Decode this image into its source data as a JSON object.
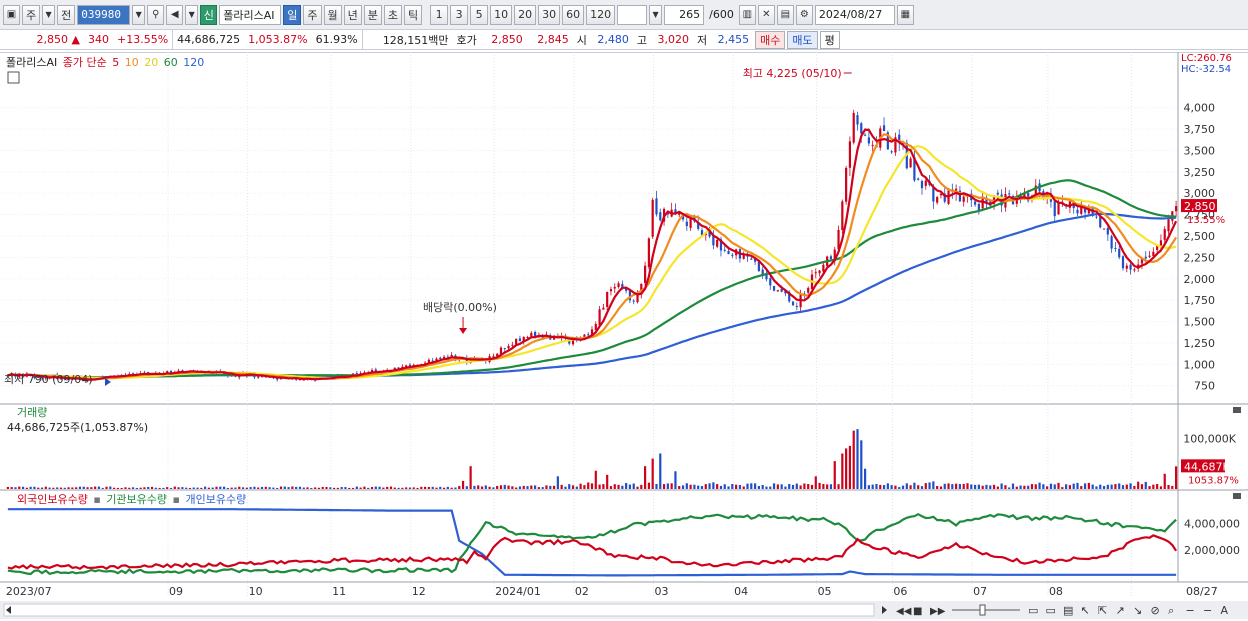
{
  "toolbar": {
    "market": "주",
    "price_type": "전",
    "code": "039980",
    "flag": "신",
    "name": "폴라리스AI",
    "periods": [
      "일",
      "주",
      "월",
      "년",
      "분",
      "초",
      "틱"
    ],
    "active_period": "일",
    "intervals": [
      "1",
      "3",
      "5",
      "10",
      "20",
      "30",
      "60",
      "120"
    ],
    "count": "265",
    "count_total": "/600",
    "date": "2024/08/27"
  },
  "quote": {
    "price": "2,850",
    "change_arrow": "▲",
    "change": "340",
    "change_pct": "+13.55%",
    "volume": "44,686,725",
    "volume_pct": "1,053.87%",
    "turnover": "61.93%",
    "trade_value": "128,151백만",
    "bid_label": "호가",
    "bid": "2,850",
    "ask": "2,845",
    "open_label": "시",
    "open": "2,480",
    "high_label": "고",
    "high": "3,020",
    "low_label": "저",
    "low": "2,455",
    "buy_button": "매수",
    "sell_button": "매도",
    "eval_button": "평"
  },
  "colors": {
    "up": "#d0021b",
    "down": "#1f4fc8",
    "ma5": "#d0021b",
    "ma10": "#f08c1e",
    "ma20": "#f5e62b",
    "ma60": "#1e8a3c",
    "ma120": "#2e5fd4",
    "foreign": "#d0021b",
    "institution": "#1e8a3c",
    "individual": "#2e5fd4"
  },
  "chart_data": [
    {
      "type": "candlestick",
      "title": "폴라리스AI",
      "legend": {
        "prefix": "종가 단순",
        "items": [
          "5",
          "10",
          "20",
          "60",
          "120"
        ]
      },
      "y_axis": {
        "ticks": [
          "4,000",
          "3,750",
          "3,500",
          "3,250",
          "3,000",
          "2,750",
          "2,500",
          "2,250",
          "2,000",
          "1,750",
          "1,500",
          "1,250",
          "1,000",
          "750"
        ],
        "ylim": [
          560,
          4300
        ]
      },
      "lc": "LC:260.76",
      "hc": "HC:-32.54",
      "last_price_label": "2,850",
      "last_pct_label": "13.55%",
      "annotations": {
        "high": "최고 4,225 (05/10)",
        "low": "최저 790 (09/04)",
        "dividend": "배당락(0.00%)"
      },
      "x_labels": [
        "2023/07",
        "09",
        "10",
        "11",
        "12",
        "2024/01",
        "02",
        "03",
        "04",
        "05",
        "06",
        "07",
        "08",
        "08/27"
      ],
      "price_anchors": [
        [
          0,
          880
        ],
        [
          10,
          860
        ],
        [
          18,
          820
        ],
        [
          27,
          850
        ],
        [
          35,
          880
        ],
        [
          44,
          900
        ],
        [
          52,
          905
        ],
        [
          60,
          880
        ],
        [
          70,
          850
        ],
        [
          78,
          830
        ],
        [
          86,
          855
        ],
        [
          95,
          900
        ],
        [
          104,
          960
        ],
        [
          110,
          1030
        ],
        [
          117,
          1090
        ],
        [
          120,
          1050
        ],
        [
          126,
          1060
        ],
        [
          133,
          1250
        ],
        [
          138,
          1350
        ],
        [
          145,
          1310
        ],
        [
          150,
          1260
        ],
        [
          154,
          1400
        ],
        [
          158,
          1800
        ],
        [
          161,
          1920
        ],
        [
          165,
          1700
        ],
        [
          168,
          2150
        ],
        [
          170,
          2850
        ],
        [
          172,
          2750
        ],
        [
          175,
          2850
        ],
        [
          178,
          2700
        ],
        [
          184,
          2500
        ],
        [
          190,
          2350
        ],
        [
          195,
          2250
        ],
        [
          200,
          2000
        ],
        [
          204,
          1820
        ],
        [
          208,
          1700
        ],
        [
          213,
          2100
        ],
        [
          218,
          2300
        ],
        [
          221,
          3200
        ],
        [
          223,
          3950
        ],
        [
          225,
          3600
        ],
        [
          230,
          3650
        ],
        [
          235,
          3550
        ],
        [
          240,
          3150
        ],
        [
          245,
          2950
        ],
        [
          250,
          3000
        ],
        [
          255,
          2850
        ],
        [
          260,
          2950
        ],
        [
          266,
          2900
        ],
        [
          272,
          3050
        ],
        [
          276,
          2800
        ],
        [
          280,
          2850
        ],
        [
          285,
          2800
        ],
        [
          290,
          2500
        ],
        [
          294,
          2150
        ],
        [
          300,
          2200
        ],
        [
          304,
          2450
        ],
        [
          308,
          2850
        ]
      ]
    },
    {
      "type": "bar",
      "title": "거래량",
      "subtitle": "44,686,725주(1,053.87%)",
      "y_axis": {
        "ticks": [
          "100,000K"
        ],
        "ylim": [
          0,
          140000
        ]
      },
      "last_value_label": "44,687K",
      "last_pct_label": "1053.87%",
      "spikes": [
        [
          120,
          16000
        ],
        [
          122,
          45000
        ],
        [
          145,
          25000
        ],
        [
          155,
          36000
        ],
        [
          158,
          28000
        ],
        [
          168,
          45000
        ],
        [
          170,
          60000
        ],
        [
          172,
          70000
        ],
        [
          176,
          35000
        ],
        [
          213,
          25000
        ],
        [
          218,
          55000
        ],
        [
          220,
          70000
        ],
        [
          221,
          80000
        ],
        [
          222,
          85000
        ],
        [
          223,
          115000
        ],
        [
          224,
          118000
        ],
        [
          225,
          96000
        ],
        [
          226,
          40000
        ],
        [
          244,
          15000
        ],
        [
          285,
          12000
        ],
        [
          300,
          14000
        ],
        [
          305,
          30000
        ],
        [
          308,
          44687
        ]
      ]
    },
    {
      "type": "line",
      "title": "",
      "series": [
        {
          "name": "외국인보유수량",
          "color_key": "foreign"
        },
        {
          "name": "기관보유수량",
          "color_key": "institution"
        },
        {
          "name": "개인보유수량",
          "color_key": "individual"
        }
      ],
      "y_axis": {
        "ticks": [
          "4,000,000",
          "2,000,000"
        ],
        "ylim": [
          -300000,
          5500000
        ]
      },
      "anchors": {
        "foreign": [
          [
            0,
            700000
          ],
          [
            30,
            700000
          ],
          [
            60,
            900000
          ],
          [
            90,
            1200000
          ],
          [
            119,
            1300000
          ],
          [
            121,
            1000000
          ],
          [
            123,
            1900000
          ],
          [
            126,
            1300000
          ],
          [
            130,
            2800000
          ],
          [
            140,
            2500000
          ],
          [
            150,
            2700000
          ],
          [
            160,
            1500000
          ],
          [
            170,
            1400000
          ],
          [
            175,
            1200000
          ],
          [
            185,
            800000
          ],
          [
            200,
            1100000
          ],
          [
            215,
            1300000
          ],
          [
            220,
            1600000
          ],
          [
            224,
            2700000
          ],
          [
            230,
            2100000
          ],
          [
            240,
            1400000
          ],
          [
            250,
            2400000
          ],
          [
            260,
            1500000
          ],
          [
            270,
            1000000
          ],
          [
            280,
            1300000
          ],
          [
            290,
            1600000
          ],
          [
            300,
            3100000
          ],
          [
            305,
            2900000
          ],
          [
            308,
            2000000
          ]
        ],
        "institution": [
          [
            0,
            300000
          ],
          [
            30,
            350000
          ],
          [
            60,
            400000
          ],
          [
            90,
            450000
          ],
          [
            118,
            450000
          ],
          [
            119,
            1400000
          ],
          [
            123,
            2800000
          ],
          [
            126,
            4100000
          ],
          [
            135,
            3200000
          ],
          [
            145,
            3000000
          ],
          [
            150,
            2800000
          ],
          [
            158,
            3300000
          ],
          [
            165,
            3900000
          ],
          [
            175,
            4300000
          ],
          [
            185,
            4600000
          ],
          [
            200,
            4500000
          ],
          [
            215,
            4300000
          ],
          [
            220,
            3800000
          ],
          [
            224,
            2600000
          ],
          [
            230,
            3600000
          ],
          [
            240,
            4700000
          ],
          [
            250,
            4000000
          ],
          [
            260,
            4600000
          ],
          [
            270,
            4400000
          ],
          [
            280,
            4500000
          ],
          [
            290,
            4000000
          ],
          [
            300,
            3600000
          ],
          [
            305,
            3500000
          ],
          [
            308,
            4400000
          ]
        ],
        "individual": [
          [
            0,
            5100000
          ],
          [
            60,
            5100000
          ],
          [
            100,
            5000000
          ],
          [
            117,
            5000000
          ],
          [
            119,
            2700000
          ],
          [
            125,
            1700000
          ],
          [
            131,
            100000
          ],
          [
            160,
            50000
          ],
          [
            200,
            100000
          ],
          [
            220,
            150000
          ],
          [
            222,
            350000
          ],
          [
            226,
            150000
          ],
          [
            260,
            100000
          ],
          [
            308,
            100000
          ]
        ]
      }
    }
  ]
}
